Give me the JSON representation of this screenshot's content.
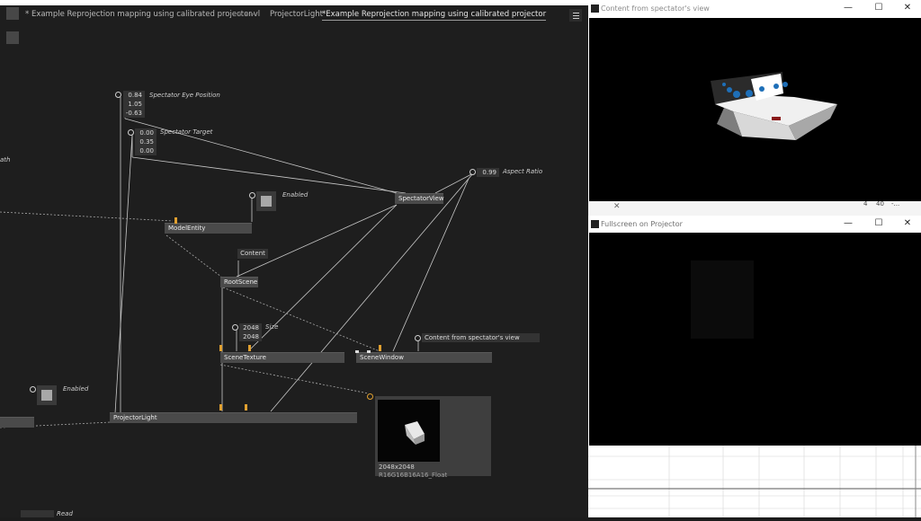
{
  "editor": {
    "tabs": [
      {
        "label": "* Example Reprojection mapping using calibrated projector.vl"
      },
      {
        "label": "ProjectorLight"
      },
      {
        "label": "*Example Reprojection mapping using calibrated projector"
      }
    ],
    "nav_arrows": "◂ ◂ ▸",
    "menu_icon": "hamburger-menu-icon"
  },
  "patch": {
    "spectator_eye_values": [
      "0.84",
      "1.05",
      "-0.63"
    ],
    "spectator_eye_comment": "Spectator Eye Position",
    "spectator_target_values": [
      "0.00",
      "0.35",
      "0.00"
    ],
    "spectator_target_comment": "Spectator Target",
    "aspect_value": "0.99",
    "aspect_comment": "Aspect Ratio",
    "enabled_comment": "Enabled",
    "enabled2_comment": "Enabled",
    "size_values": [
      "2048",
      "2048"
    ],
    "size_comment": "Size",
    "content_box_label": "Content",
    "window_title_value": "Content from spectator's view",
    "cut_comment": "ath",
    "read_comment": "Read",
    "nodes": {
      "spectator_view": "SpectatorView",
      "model_entity": "ModelEntity",
      "root_scene": "RootScene",
      "scene_texture": "SceneTexture",
      "scene_window": "SceneWindow",
      "projector_light": "ProjectorLight"
    },
    "preview": {
      "resolution": "2048x2048",
      "format": "R16G16B16A16_Float"
    }
  },
  "windows": {
    "spectator": {
      "title": "Content from spectator's view",
      "bottom_values": [
        "4",
        "40",
        "-..."
      ]
    },
    "projector": {
      "title": "Fullscreen on Projector"
    },
    "controls": {
      "minimize": "—",
      "maximize": "☐",
      "close": "✕"
    }
  },
  "colors": {
    "patch_bg": "#1e1e1e",
    "link": "#bdbdbd",
    "pin_accent": "#e0a030",
    "node": "#4a4a4a"
  }
}
